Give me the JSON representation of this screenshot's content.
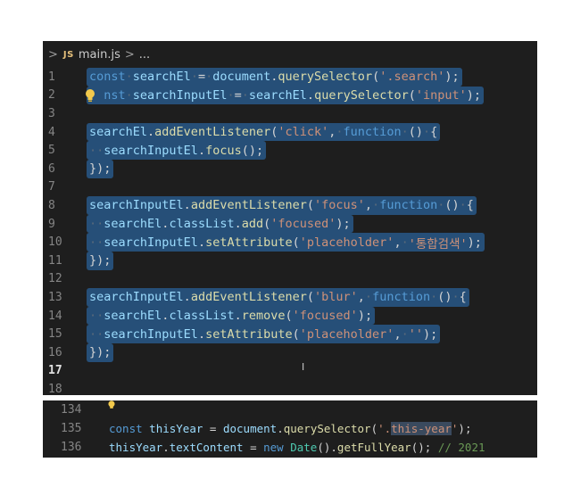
{
  "breadcrumb": {
    "badge": "JS",
    "file": "main.js",
    "more": "..."
  },
  "editor": {
    "line_numbers": [
      "1",
      "2",
      "3",
      "4",
      "5",
      "6",
      "7",
      "8",
      "9",
      "10",
      "11",
      "12",
      "13",
      "14",
      "15",
      "16",
      "17",
      "18"
    ],
    "current_line": "17",
    "lines": [
      {
        "tokens": [
          [
            "kw",
            "const"
          ],
          [
            "ws",
            "·"
          ],
          [
            "id",
            "searchEl"
          ],
          [
            "ws",
            "·"
          ],
          [
            "pn",
            "="
          ],
          [
            "ws",
            "·"
          ],
          [
            "id",
            "document"
          ],
          [
            "pn",
            "."
          ],
          [
            "fn",
            "querySelector"
          ],
          [
            "pn",
            "("
          ],
          [
            "str",
            "'.search'"
          ],
          [
            "pn",
            ");"
          ]
        ],
        "sel": true
      },
      {
        "tokens": [
          [
            "kw",
            "nst"
          ],
          [
            "ws",
            "·"
          ],
          [
            "id",
            "searchInputEl"
          ],
          [
            "ws",
            "·"
          ],
          [
            "pn",
            "="
          ],
          [
            "ws",
            "·"
          ],
          [
            "id",
            "searchEl"
          ],
          [
            "pn",
            "."
          ],
          [
            "fn",
            "querySelector"
          ],
          [
            "pn",
            "("
          ],
          [
            "str",
            "'input'"
          ],
          [
            "pn",
            ");"
          ]
        ],
        "sel": true,
        "indent": "  "
      },
      {
        "tokens": [],
        "sel": false
      },
      {
        "tokens": [
          [
            "id",
            "searchEl"
          ],
          [
            "pn",
            "."
          ],
          [
            "fn",
            "addEventListener"
          ],
          [
            "pn",
            "("
          ],
          [
            "str",
            "'click'"
          ],
          [
            "pn",
            ","
          ],
          [
            "ws",
            "·"
          ],
          [
            "kw",
            "function"
          ],
          [
            "ws",
            "·"
          ],
          [
            "pn",
            "()"
          ],
          [
            "ws",
            "·"
          ],
          [
            "pn",
            "{"
          ]
        ],
        "sel": true
      },
      {
        "tokens": [
          [
            "ws",
            "··"
          ],
          [
            "id",
            "searchInputEl"
          ],
          [
            "pn",
            "."
          ],
          [
            "fn",
            "focus"
          ],
          [
            "pn",
            "();"
          ]
        ],
        "sel": true
      },
      {
        "tokens": [
          [
            "pn",
            "});"
          ]
        ],
        "sel": true
      },
      {
        "tokens": [],
        "sel": false
      },
      {
        "tokens": [
          [
            "id",
            "searchInputEl"
          ],
          [
            "pn",
            "."
          ],
          [
            "fn",
            "addEventListener"
          ],
          [
            "pn",
            "("
          ],
          [
            "str",
            "'focus'"
          ],
          [
            "pn",
            ","
          ],
          [
            "ws",
            "·"
          ],
          [
            "kw",
            "function"
          ],
          [
            "ws",
            "·"
          ],
          [
            "pn",
            "()"
          ],
          [
            "ws",
            "·"
          ],
          [
            "pn",
            "{"
          ]
        ],
        "sel": true
      },
      {
        "tokens": [
          [
            "ws",
            "··"
          ],
          [
            "id",
            "searchEl"
          ],
          [
            "pn",
            "."
          ],
          [
            "id",
            "classList"
          ],
          [
            "pn",
            "."
          ],
          [
            "fn",
            "add"
          ],
          [
            "pn",
            "("
          ],
          [
            "str",
            "'focused'"
          ],
          [
            "pn",
            ");"
          ]
        ],
        "sel": true
      },
      {
        "tokens": [
          [
            "ws",
            "··"
          ],
          [
            "id",
            "searchInputEl"
          ],
          [
            "pn",
            "."
          ],
          [
            "fn",
            "setAttribute"
          ],
          [
            "pn",
            "("
          ],
          [
            "str",
            "'placeholder'"
          ],
          [
            "pn",
            ","
          ],
          [
            "ws",
            "·"
          ],
          [
            "str",
            "'통합검색'"
          ],
          [
            "pn",
            ");"
          ]
        ],
        "sel": true
      },
      {
        "tokens": [
          [
            "pn",
            "});"
          ]
        ],
        "sel": true
      },
      {
        "tokens": [],
        "sel": false
      },
      {
        "tokens": [
          [
            "id",
            "searchInputEl"
          ],
          [
            "pn",
            "."
          ],
          [
            "fn",
            "addEventListener"
          ],
          [
            "pn",
            "("
          ],
          [
            "str",
            "'blur'"
          ],
          [
            "pn",
            ","
          ],
          [
            "ws",
            "·"
          ],
          [
            "kw",
            "function"
          ],
          [
            "ws",
            "·"
          ],
          [
            "pn",
            "()"
          ],
          [
            "ws",
            "·"
          ],
          [
            "pn",
            "{"
          ]
        ],
        "sel": true
      },
      {
        "tokens": [
          [
            "ws",
            "··"
          ],
          [
            "id",
            "searchEl"
          ],
          [
            "pn",
            "."
          ],
          [
            "id",
            "classList"
          ],
          [
            "pn",
            "."
          ],
          [
            "fn",
            "remove"
          ],
          [
            "pn",
            "("
          ],
          [
            "str",
            "'focused'"
          ],
          [
            "pn",
            ");"
          ]
        ],
        "sel": true
      },
      {
        "tokens": [
          [
            "ws",
            "··"
          ],
          [
            "id",
            "searchInputEl"
          ],
          [
            "pn",
            "."
          ],
          [
            "fn",
            "setAttribute"
          ],
          [
            "pn",
            "("
          ],
          [
            "str",
            "'placeholder'"
          ],
          [
            "pn",
            ","
          ],
          [
            "ws",
            "·"
          ],
          [
            "str",
            "''"
          ],
          [
            "pn",
            ");"
          ]
        ],
        "sel": true
      },
      {
        "tokens": [
          [
            "pn",
            "});"
          ]
        ],
        "sel": true
      },
      {
        "tokens": [],
        "sel": false
      },
      {
        "tokens": [],
        "sel": false
      }
    ]
  },
  "editor2": {
    "line_numbers": [
      "134",
      "135",
      "136"
    ],
    "lines": [
      {
        "tokens": []
      },
      {
        "tokens": [
          [
            "kw",
            "const"
          ],
          [
            "pn",
            " "
          ],
          [
            "id",
            "thisYear"
          ],
          [
            "pn",
            " = "
          ],
          [
            "id",
            "document"
          ],
          [
            "pn",
            "."
          ],
          [
            "fn",
            "querySelector"
          ],
          [
            "pn",
            "("
          ],
          [
            "str",
            "'."
          ],
          [
            "hl",
            "this-year"
          ],
          [
            "str",
            "'"
          ],
          [
            "pn",
            ");"
          ]
        ]
      },
      {
        "tokens": [
          [
            "id",
            "thisYear"
          ],
          [
            "pn",
            "."
          ],
          [
            "id",
            "textContent"
          ],
          [
            "pn",
            " = "
          ],
          [
            "kw",
            "new"
          ],
          [
            "pn",
            " "
          ],
          [
            "ty",
            "Date"
          ],
          [
            "pn",
            "()."
          ],
          [
            "fn",
            "getFullYear"
          ],
          [
            "pn",
            "(); "
          ],
          [
            "cm",
            "// 2021"
          ]
        ]
      }
    ]
  },
  "icons": [
    "chevron-right-icon",
    "lightbulb-icon",
    "text-cursor-icon"
  ]
}
